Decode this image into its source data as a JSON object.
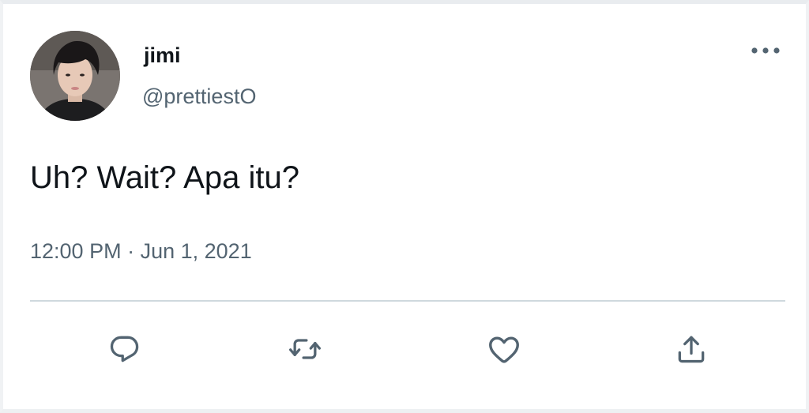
{
  "tweet": {
    "author": {
      "display_name": "jimi",
      "handle": "@prettiestO",
      "avatar": "profile-photo"
    },
    "text": "Uh? Wait? Apa itu?",
    "time": "12:00 PM",
    "separator": "·",
    "date": "Jun 1, 2021",
    "more_icon": "more-horizontal-icon"
  },
  "actions": [
    {
      "name": "reply",
      "icon": "reply-icon"
    },
    {
      "name": "retweet",
      "icon": "retweet-icon"
    },
    {
      "name": "like",
      "icon": "heart-icon"
    },
    {
      "name": "share",
      "icon": "share-icon"
    }
  ],
  "colors": {
    "text_primary": "#0f1419",
    "text_secondary": "#536471",
    "divider": "#cfd9de",
    "background": "#ffffff"
  }
}
